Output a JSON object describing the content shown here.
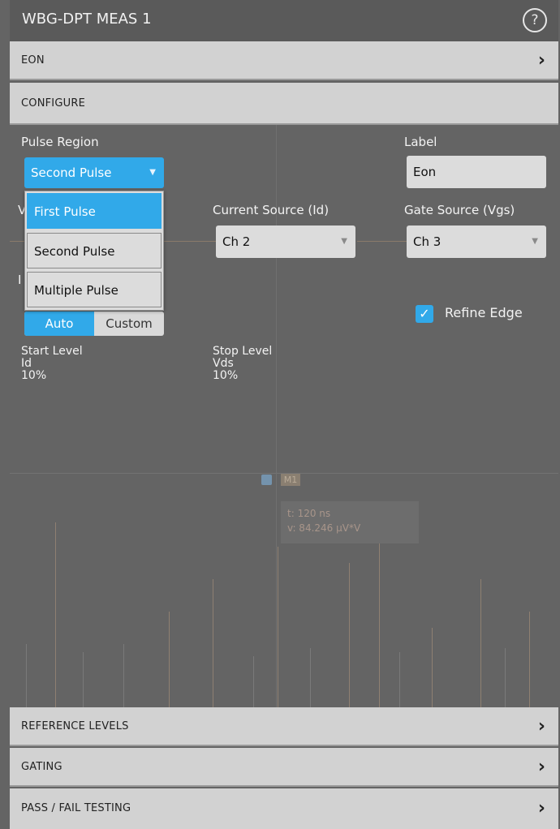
{
  "header": {
    "title": "WBG-DPT MEAS 1",
    "help_icon": "?"
  },
  "sections": {
    "eon": "EON",
    "configure": "CONFIGURE",
    "reference_levels": "REFERENCE LEVELS",
    "gating": "GATING",
    "pass_fail": "PASS / FAIL TESTING",
    "chevron": "›"
  },
  "configure": {
    "pulse_region": {
      "label": "Pulse Region",
      "value": "Second Pulse",
      "options": [
        "First Pulse",
        "Second Pulse",
        "Multiple Pulse"
      ],
      "highlighted_option": "First Pulse"
    },
    "label_field": {
      "label": "Label",
      "value": "Eon"
    },
    "voltage_source_label_partial": "V",
    "current_source": {
      "label": "Current Source (Id)",
      "value": "Ch 2"
    },
    "gate_source": {
      "label": "Gate Source (Vgs)",
      "value": "Ch 3"
    },
    "edge_mode_label_partial": "I",
    "edge_mode": {
      "auto": "Auto",
      "custom": "Custom",
      "selected": "Auto"
    },
    "refine_edge": {
      "label": "Refine Edge",
      "checked": true,
      "check_glyph": "✓"
    },
    "start_level": {
      "label": "Start Level",
      "source": "Id",
      "value": "10%"
    },
    "stop_level": {
      "label": "Stop Level",
      "source": "Vds",
      "value": "10%"
    }
  },
  "background_waveform": {
    "marker_tag": "M1",
    "readout_time": "t: 120 ns",
    "readout_value": "v: 84.246 µV*V"
  },
  "colors": {
    "accent": "#31a9e9",
    "panel": "#646464",
    "section_bar": "#d2d2d2",
    "field": "#dcdcdc"
  }
}
